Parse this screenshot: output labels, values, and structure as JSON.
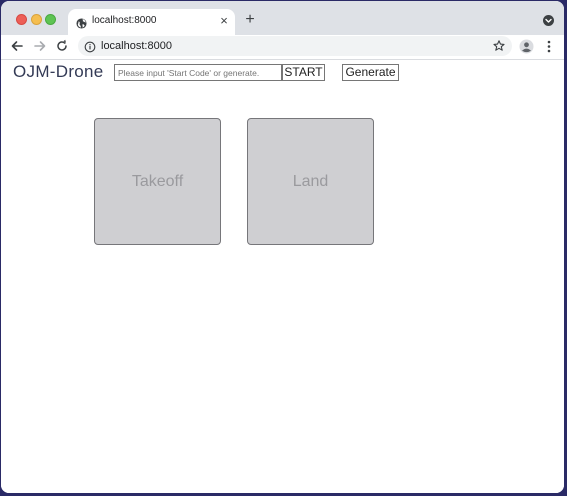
{
  "browser": {
    "tab": {
      "title": "localhost:8000",
      "favicon": "globe-icon"
    },
    "new_tab_symbol": "+",
    "close_symbol": "×",
    "address": "localhost:8000",
    "icons": {
      "back": "back-arrow-icon",
      "forward": "forward-arrow-icon",
      "reload": "reload-icon",
      "info": "info-icon",
      "bookmark": "star-icon",
      "profile": "profile-icon",
      "menu": "kebab-menu-icon",
      "tab_search": "tab-search-icon"
    },
    "colors": {
      "tabstrip": "#dee1e6",
      "omnibox": "#f1f3f4",
      "close": "#ed5f57",
      "minimize": "#f5be4f",
      "maximize": "#5ec453"
    }
  },
  "page": {
    "brand": "OJM-Drone",
    "code_input": {
      "value": "",
      "placeholder": "Please input 'Start Code' or generate."
    },
    "start_label": "START",
    "generate_label": "Generate",
    "pads": {
      "takeoff_label": "Takeoff",
      "land_label": "Land"
    },
    "colors": {
      "pad_fill": "#cfcfd2",
      "pad_text": "#9a9a9e",
      "brand_text": "#333a55"
    }
  }
}
